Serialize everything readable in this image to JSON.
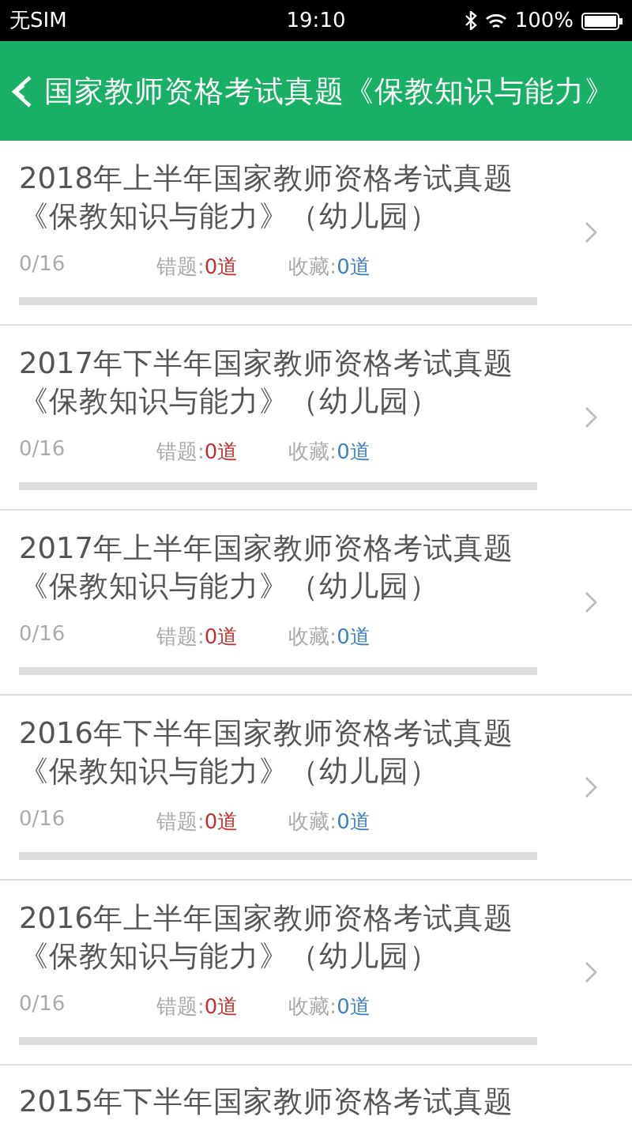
{
  "status_bar": {
    "carrier": "无SIM",
    "time": "19:10",
    "battery": "100%"
  },
  "header": {
    "title": "国家教师资格考试真题《保教知识与能力》"
  },
  "items": [
    {
      "title": "2018年上半年国家教师资格考试真题《保教知识与能力》（幼儿园）",
      "progress": "0/16",
      "wrong_label": "错题:",
      "wrong": "0道",
      "fav_label": "收藏:",
      "fav": "0道",
      "level": 0
    },
    {
      "title": "2017年下半年国家教师资格考试真题《保教知识与能力》（幼儿园）",
      "progress": "0/16",
      "wrong_label": "错题:",
      "wrong": "0道",
      "fav_label": "收藏:",
      "fav": "0道",
      "level": 0
    },
    {
      "title": "2017年上半年国家教师资格考试真题《保教知识与能力》（幼儿园）",
      "progress": "0/16",
      "wrong_label": "错题:",
      "wrong": "0道",
      "fav_label": "收藏:",
      "fav": "0道",
      "level": 0
    },
    {
      "title": "2016年下半年国家教师资格考试真题《保教知识与能力》（幼儿园）",
      "progress": "0/16",
      "wrong_label": "错题:",
      "wrong": "0道",
      "fav_label": "收藏:",
      "fav": "0道",
      "level": 0
    },
    {
      "title": "2016年上半年国家教师资格考试真题《保教知识与能力》（幼儿园）",
      "progress": "0/16",
      "wrong_label": "错题:",
      "wrong": "0道",
      "fav_label": "收藏:",
      "fav": "0道",
      "level": 0
    }
  ],
  "partial_item": {
    "title": "2015年下半年国家教师资格考试真题"
  }
}
